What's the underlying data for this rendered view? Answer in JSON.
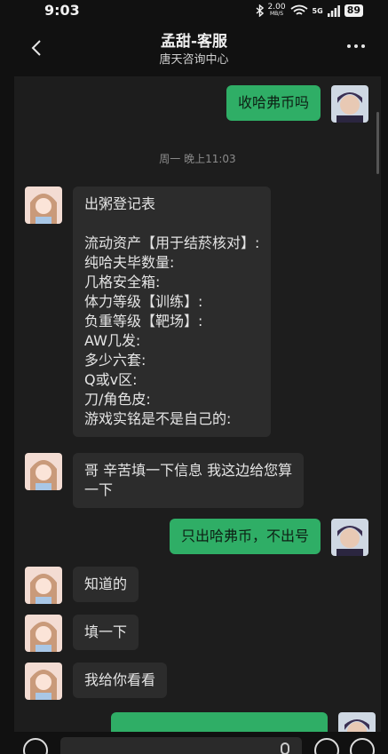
{
  "status": {
    "time": "9:03",
    "net_speed": "2.00",
    "net_unit": "MB/S",
    "network": "5G",
    "battery": "89"
  },
  "header": {
    "title": "孟甜-客服",
    "subtitle": "唐天咨询中心"
  },
  "colors": {
    "accent_green": "#2fae66",
    "bubble_gray": "#2c2c2c",
    "background": "#1d1d1d"
  },
  "messages": [
    {
      "side": "right",
      "text": "收哈弗币吗"
    },
    {
      "side": "left",
      "text": "出粥登记表\n\n流动资产【用于结菸核对】:\n纯哈夫毕数量:\n几格安全箱:\n体力等级【训练】:\n负重等级【靶场】:\nAW几发:\n多少六套:\nQ或v区:\n刀/角色皮:\n游戏实铭是不是自己的:"
    },
    {
      "side": "left",
      "text": "哥 辛苦填一下信息 我这边给您算\n一下"
    },
    {
      "side": "right",
      "text": "只出哈弗币，不出号"
    },
    {
      "side": "left",
      "text": "知道的"
    },
    {
      "side": "left",
      "text": "填一下"
    },
    {
      "side": "left",
      "text": "我给你看看"
    }
  ],
  "timestamp": "周一 晚上11:03"
}
